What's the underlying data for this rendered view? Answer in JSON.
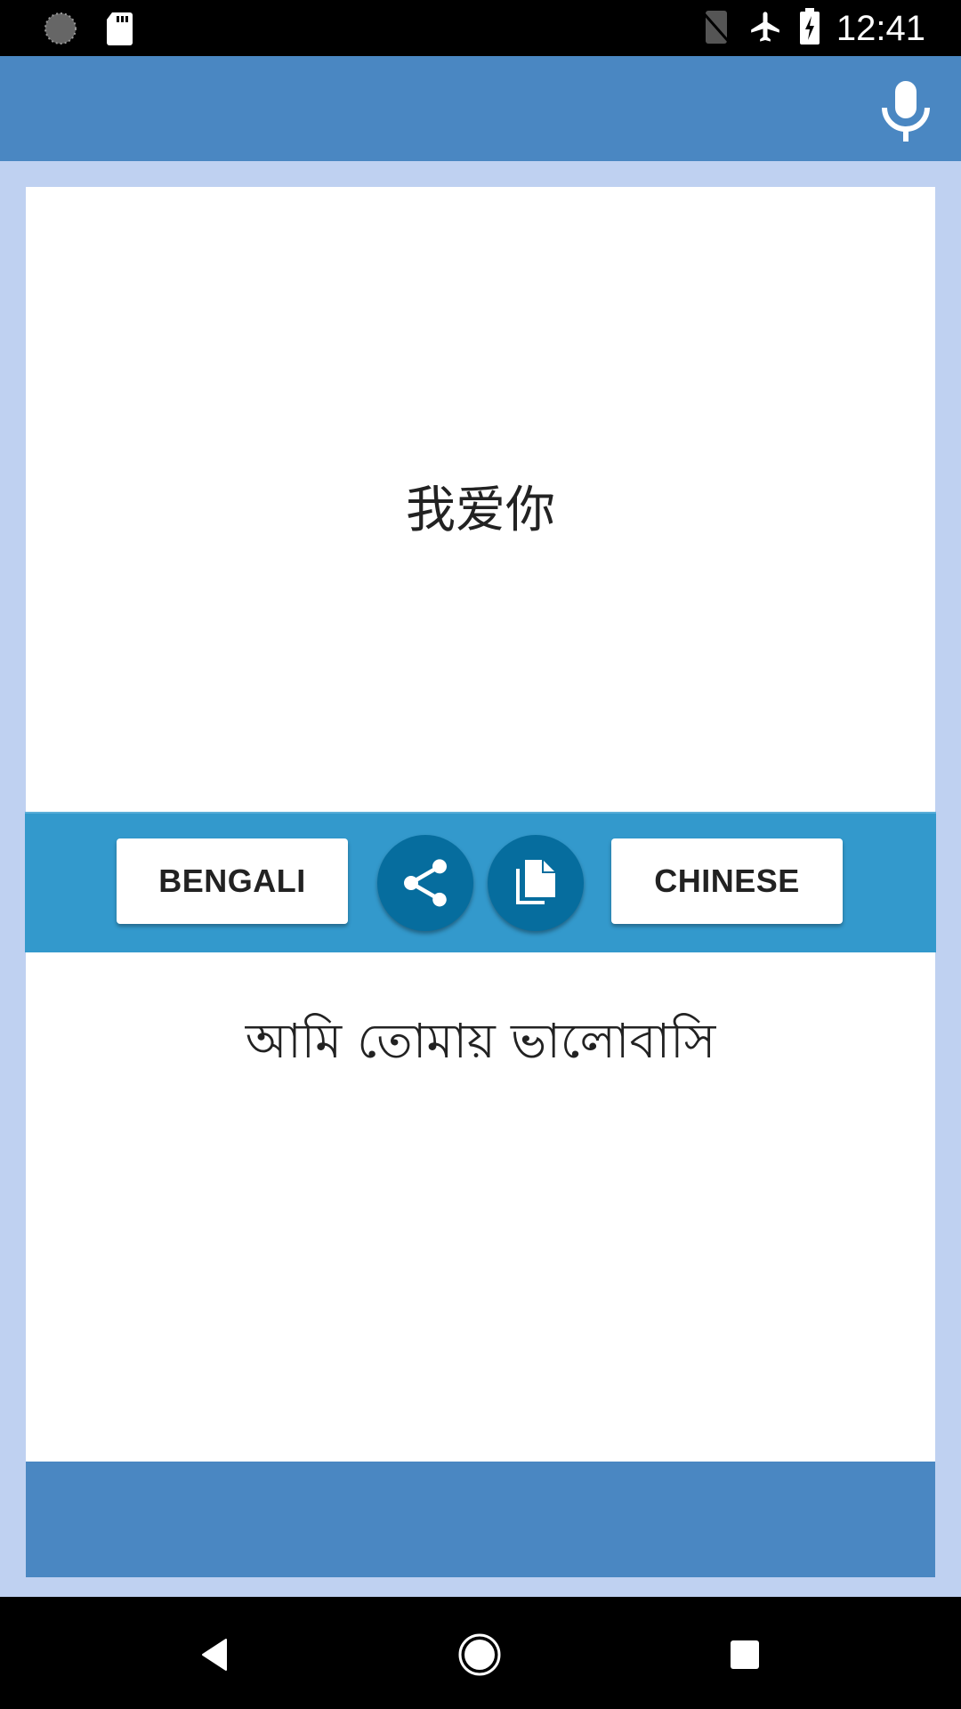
{
  "status_bar": {
    "time": "12:41",
    "icons": [
      "loading-icon",
      "sd-card-icon",
      "no-sim-icon",
      "airplane-mode-icon",
      "battery-charging-icon"
    ]
  },
  "app_bar": {
    "mic_icon": "microphone-icon"
  },
  "translation": {
    "source_text": "我爱你",
    "target_text": "আমি তোমায় ভালোবাসি"
  },
  "toolbar": {
    "left_language": "BENGALI",
    "right_language": "CHINESE",
    "share_icon": "share-icon",
    "copy_icon": "copy-icon"
  },
  "colors": {
    "app_bar": "#4a87c2",
    "background": "#bfd1f1",
    "toolbar": "#3399cc",
    "circle_button": "#066d9e"
  },
  "nav_bar": {
    "buttons": [
      "back",
      "home",
      "recents"
    ]
  }
}
